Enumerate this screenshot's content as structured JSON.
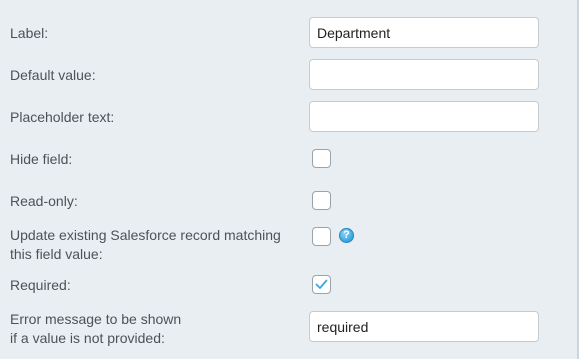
{
  "fields": {
    "label": {
      "label": "Label:",
      "value": "Department"
    },
    "default_value": {
      "label": "Default value:",
      "value": ""
    },
    "placeholder_text": {
      "label": "Placeholder text:",
      "value": ""
    },
    "hide_field": {
      "label": "Hide field:",
      "checked": false
    },
    "read_only": {
      "label": "Read-only:",
      "checked": false
    },
    "update_existing": {
      "label_line1": "Update existing Salesforce record matching",
      "label_line2": "this field value:",
      "checked": false,
      "help_glyph": "?"
    },
    "required": {
      "label": "Required:",
      "checked": true
    },
    "error_message": {
      "label_line1": "Error message to be shown",
      "label_line2": "if a value is not provided:",
      "value": "required"
    }
  },
  "colors": {
    "background": "#e8eef2",
    "checkmark": "#3ca6df",
    "help_icon": "#3ca6df"
  },
  "icons": {
    "help": "question-circle-icon",
    "check": "checkmark-icon"
  }
}
